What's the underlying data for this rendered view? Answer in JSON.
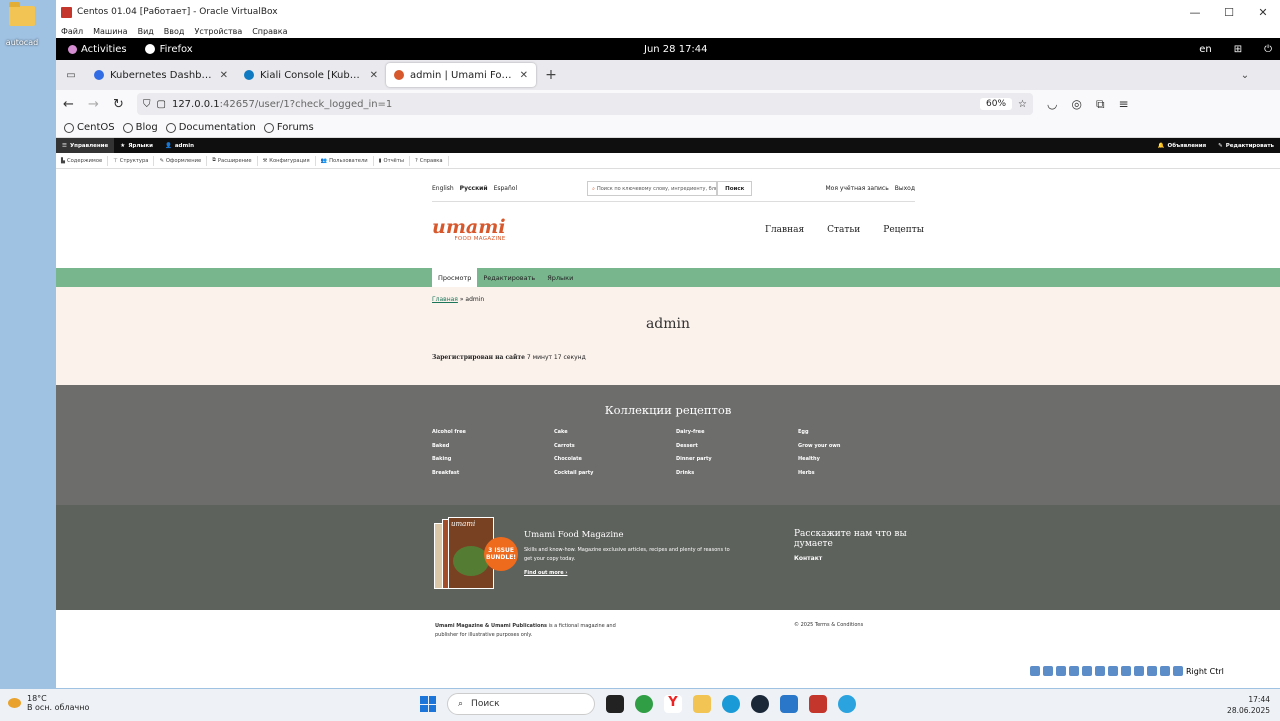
{
  "desktop": {
    "icon_label": "autocad"
  },
  "vbox": {
    "title": "Centos 01.04 [Работает] - Oracle VirtualBox",
    "menu": [
      "Файл",
      "Машина",
      "Вид",
      "Ввод",
      "Устройства",
      "Справка"
    ],
    "minimize": "—",
    "maximize": "☐",
    "close": "✕"
  },
  "gnome": {
    "activities": "Activities",
    "app": "Firefox",
    "clock": "Jun 28  17:44",
    "lang": "en"
  },
  "browser": {
    "tabs": [
      {
        "label": "Kubernetes Dashboard",
        "color": "#326ce5"
      },
      {
        "label": "Kiali Console [Kubernetes]",
        "color": "#0f7ac2"
      },
      {
        "label": "admin | Umami Food Magazine",
        "color": "#d7582c"
      }
    ],
    "url_host": "127.0.0.1",
    "url_rest": ":42657/user/1?check_logged_in=1",
    "zoom": "60%",
    "bookmarks": [
      "CentOS",
      "Blog",
      "Documentation",
      "Forums"
    ]
  },
  "drupal": {
    "toolbar1": [
      "Управление",
      "Ярлыки",
      "admin"
    ],
    "toolbar1_right": [
      "Объявления",
      "Редактировать"
    ],
    "toolbar2": [
      "Содержимое",
      "Структура",
      "Оформление",
      "Расширение",
      "Конфигурация",
      "Пользователи",
      "Отчёты",
      "Справка"
    ]
  },
  "site": {
    "languages": [
      "English",
      "Русский",
      "Español"
    ],
    "search_placeholder": "Поиск по ключевому слову, ингредиенту, блюду",
    "search_button": "Поиск",
    "account": "Моя учётная запись",
    "logout": "Выход",
    "logo": "umami",
    "logo_sub": "FOOD MAGAZINE",
    "nav": [
      "Главная",
      "Статьи",
      "Рецепты"
    ],
    "local_tabs": [
      "Просмотр",
      "Редактировать",
      "Ярлыки"
    ],
    "breadcrumb_home": "Главная",
    "breadcrumb_current": " » admin",
    "title": "admin",
    "registered_label": "Зарегистрирован на сайте",
    "registered_value": " 7 минут 17 секунд",
    "collections_title": "Коллекции рецептов",
    "collections": [
      "Alcohol free",
      "Cake",
      "Dairy-free",
      "Egg",
      "Baked",
      "Carrots",
      "Dessert",
      "Grow your own",
      "Baking",
      "Chocolate",
      "Dinner party",
      "Healthy",
      "Breakfast",
      "Cocktail party",
      "Drinks",
      "Herbs"
    ],
    "mag_title": "Umami Food Magazine",
    "mag_text": "Skills and know-how. Magazine exclusive articles, recipes and plenty of reasons to get your copy today.",
    "mag_link": "Find out more ›",
    "badge_line1": "3 ISSUE",
    "badge_line2": "BUNDLE!",
    "cover_logo": "umami",
    "tell_title": "Расскажите нам что вы думаете",
    "tell_link": "Контакт",
    "footer_bold": "Umami Magazine & Umami Publications",
    "footer_text": " is a fictional magazine and publisher for illustrative purposes only.",
    "footer_copy": "© 2025 Terms & Conditions"
  },
  "vbox_status": {
    "host_key": "Right Ctrl"
  },
  "taskbar": {
    "temp": "18°C",
    "weather": "В осн. облачно",
    "search": "Поиск",
    "time": "17:44",
    "date": "28.06.2025"
  }
}
